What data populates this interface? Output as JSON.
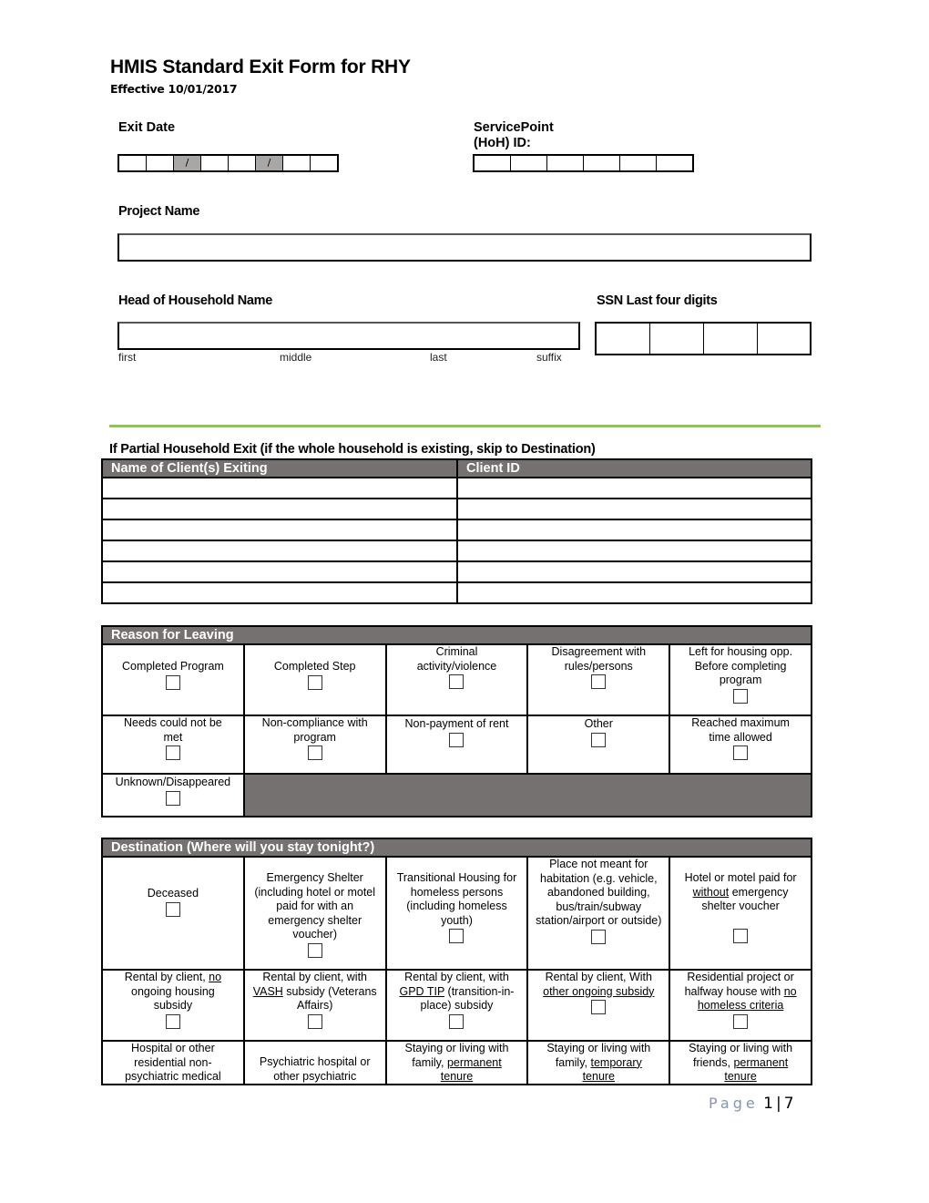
{
  "header": {
    "title": "HMIS Standard Exit Form for RHY",
    "effective": "Effective 10/01/2017"
  },
  "exit_date": {
    "label": "Exit Date",
    "separator": "/"
  },
  "servicepoint": {
    "label_line1": "ServicePoint",
    "label_line2": "(HoH) ID:"
  },
  "project_name": {
    "label": "Project Name",
    "value": ""
  },
  "head_of_household": {
    "label": "Head of Household Name",
    "value": "",
    "sublabels": [
      "first",
      "middle",
      "last",
      "suffix"
    ]
  },
  "ssn": {
    "label": "SSN Last four digits"
  },
  "partial_exit": {
    "title": "If Partial Household Exit (if the whole household is existing, skip to Destination)",
    "columns": [
      "Name of Client(s) Exiting",
      "Client ID"
    ],
    "rows": [
      [
        "",
        ""
      ],
      [
        "",
        ""
      ],
      [
        "",
        ""
      ],
      [
        "",
        ""
      ],
      [
        "",
        ""
      ],
      [
        "",
        ""
      ]
    ]
  },
  "reason_for_leaving": {
    "title": "Reason for Leaving",
    "options": [
      {
        "label": "Completed Program",
        "checked": false
      },
      {
        "label": "Completed Step",
        "checked": false
      },
      {
        "label": "Criminal activity/violence",
        "checked": false
      },
      {
        "label": "Disagreement with rules/persons",
        "checked": false
      },
      {
        "label": "Left for housing opp. Before completing program",
        "checked": false
      },
      {
        "label": "Needs could not be met",
        "checked": false
      },
      {
        "label": "Non-compliance with program",
        "checked": false
      },
      {
        "label": "Non-payment of rent",
        "checked": false
      },
      {
        "label": "Other",
        "checked": false
      },
      {
        "label": "Reached maximum time allowed",
        "checked": false
      },
      {
        "label": "Unknown/Disappeared",
        "checked": false
      }
    ]
  },
  "destination": {
    "title": "Destination (Where will you stay tonight?)",
    "options": [
      {
        "label": "Deceased",
        "checked": false
      },
      {
        "label": "Emergency Shelter (including hotel or motel paid for with an emergency shelter voucher)",
        "checked": false
      },
      {
        "label": "Transitional Housing for homeless persons (including homeless youth)",
        "checked": false
      },
      {
        "label": "Place not meant for habitation (e.g. vehicle, abandoned building, bus/train/subway station/airport or outside)",
        "checked": false
      },
      {
        "label": "Hotel or motel paid for without emergency shelter voucher",
        "underline": "without",
        "checked": false
      },
      {
        "label": "Rental by client, no ongoing housing subsidy",
        "underline": "no",
        "checked": false
      },
      {
        "label": "Rental by client, with VASH subsidy (Veterans Affairs)",
        "underline": "VASH",
        "checked": false
      },
      {
        "label": "Rental by client, with GPD TIP (transition-in-place) subsidy",
        "underline": "GPD TIP",
        "checked": false
      },
      {
        "label": "Rental by client, With other ongoing subsidy",
        "underline": "other ongoing subsidy",
        "checked": false
      },
      {
        "label": "Residential project or halfway house with no homeless criteria",
        "underline": "no homeless criteria",
        "checked": false
      },
      {
        "label": "Hospital or other residential non-psychiatric medical",
        "checked": false
      },
      {
        "label": "Psychiatric hospital or other psychiatric",
        "checked": false
      },
      {
        "label": "Staying or living with family, permanent tenure",
        "underline": "permanent tenure",
        "checked": false
      },
      {
        "label": "Staying or living with family, temporary tenure",
        "underline": "temporary tenure",
        "checked": false
      },
      {
        "label": "Staying or living with friends, permanent tenure",
        "underline": "permanent tenure",
        "checked": false
      }
    ]
  },
  "footer": {
    "page_word": "Page",
    "page_current": "1",
    "page_total": "7"
  }
}
